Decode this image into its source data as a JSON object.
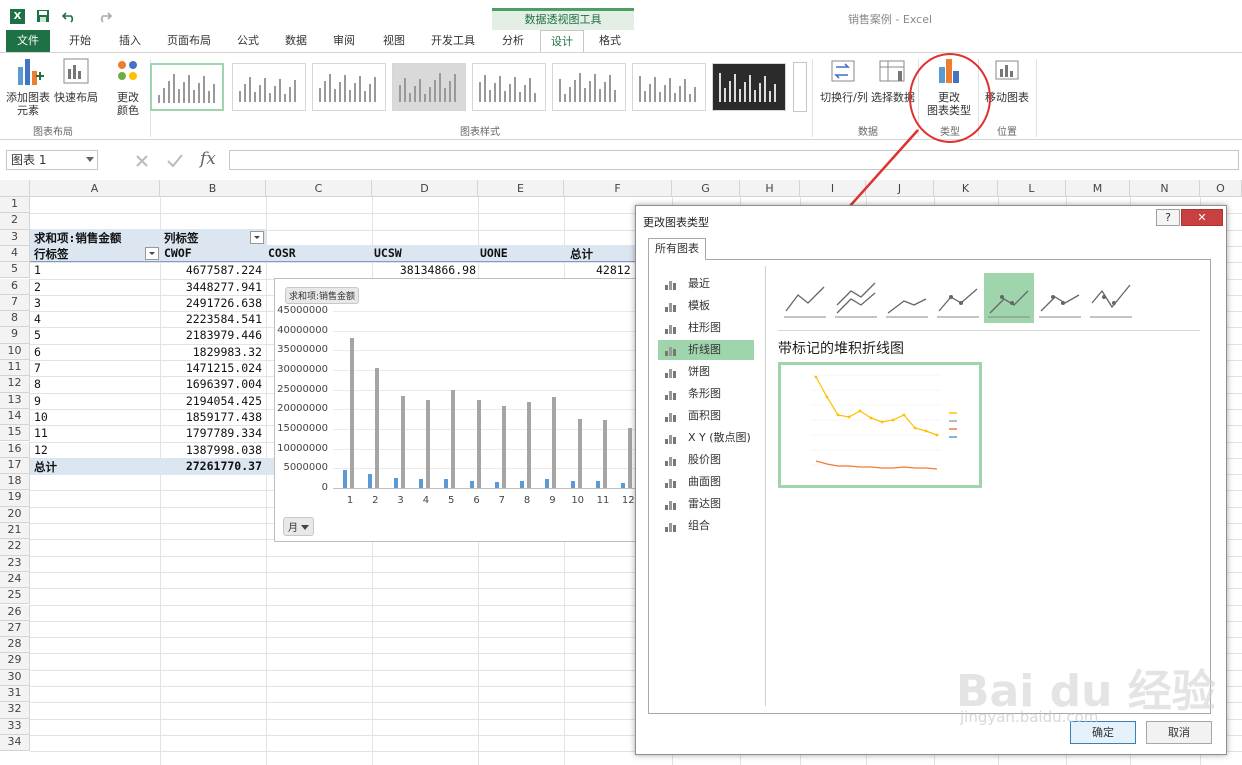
{
  "window": {
    "title": "销售案例 - Excel",
    "context_tool_title": "数据透视图工具"
  },
  "tabs": [
    "文件",
    "开始",
    "插入",
    "页面布局",
    "公式",
    "数据",
    "审阅",
    "视图",
    "开发工具",
    "分析",
    "设计",
    "格式"
  ],
  "ribbon": {
    "add_element_l1": "添加图表",
    "add_element_l2": "元素",
    "quick_layout": "快速布局",
    "change_color_l1": "更改",
    "change_color_l2": "颜色",
    "group_layout": "图表布局",
    "group_styles": "图表样式",
    "switch_rowcol": "切换行/列",
    "select_data": "选择数据",
    "change_type_l1": "更改",
    "change_type_l2": "图表类型",
    "move_chart": "移动图表",
    "group_data": "数据",
    "group_type": "类型",
    "group_location": "位置"
  },
  "formula_bar": {
    "name_box": "图表 1",
    "fx": "fx"
  },
  "columns": [
    "A",
    "B",
    "C",
    "D",
    "E",
    "F",
    "G",
    "H",
    "I",
    "J",
    "K",
    "L",
    "M",
    "N",
    "O"
  ],
  "rows": [
    "1",
    "2",
    "3",
    "4",
    "5",
    "6",
    "7",
    "8",
    "9",
    "10",
    "11",
    "12",
    "13",
    "14",
    "15",
    "16",
    "17",
    "18",
    "19",
    "20",
    "21",
    "22",
    "23",
    "24",
    "25",
    "26",
    "27",
    "28",
    "29",
    "30",
    "31",
    "32",
    "33",
    "34"
  ],
  "pivot": {
    "value_field": "求和项:销售金额",
    "col_labels": "列标签",
    "row_labels": "行标签",
    "headers": [
      "CWOF",
      "COSR",
      "UCSW",
      "UONE",
      "总计"
    ],
    "ucsw_row5": "38134866.98",
    "total_row5_partial": "42812",
    "row_keys": [
      "1",
      "2",
      "3",
      "4",
      "5",
      "6",
      "7",
      "8",
      "9",
      "10",
      "11",
      "12"
    ],
    "cwof_values": [
      "4677587.224",
      "3448277.941",
      "2491726.638",
      "2223584.541",
      "2183979.446",
      "1829983.32",
      "1471215.024",
      "1696397.004",
      "2194054.425",
      "1859177.438",
      "1797789.334",
      "1387998.038"
    ],
    "grand_total_label": "总计",
    "grand_total_cwof": "27261770.37"
  },
  "chart_data": {
    "type": "bar",
    "title": "求和项:销售金额",
    "categories": [
      "1",
      "2",
      "3",
      "4",
      "5",
      "6",
      "7",
      "8",
      "9",
      "10",
      "11",
      "12"
    ],
    "yticks": [
      "45000000",
      "40000000",
      "35000000",
      "30000000",
      "25000000",
      "20000000",
      "15000000",
      "10000000",
      "5000000",
      "0"
    ],
    "ylim": [
      0,
      45000000
    ],
    "series": [
      {
        "values": [
          4677587,
          3448278,
          2491727,
          2223585,
          2183979,
          1829983,
          1471215,
          1696397,
          2194054,
          1859177,
          1797789,
          1387998
        ],
        "color": "#5b9bd5"
      },
      {
        "values": [
          38134867,
          30400000,
          23400000,
          22500000,
          24800000,
          22300000,
          20800000,
          21800000,
          23200000,
          17600000,
          17200000,
          15200000
        ],
        "color": "#a5a5a5"
      }
    ],
    "filter_button": "月"
  },
  "dialog": {
    "title": "更改图表类型",
    "help": "?",
    "close": "✕",
    "tab": "所有图表",
    "categories": [
      "最近",
      "模板",
      "柱形图",
      "折线图",
      "饼图",
      "条形图",
      "面积图",
      "X Y (散点图)",
      "股价图",
      "曲面图",
      "雷达图",
      "组合"
    ],
    "selected_category": "折线图",
    "selected_subtype_title": "带标记的堆积折线图",
    "ok": "确定",
    "cancel": "取消"
  },
  "watermark": {
    "main": "Bai du 经验",
    "url": "jingyan.baidu.com"
  },
  "colors": {
    "excel_green": "#1e7145",
    "selection_green": "#9fd5ad",
    "pivot_band": "#dce6f1",
    "annotation_red": "#e03030"
  }
}
